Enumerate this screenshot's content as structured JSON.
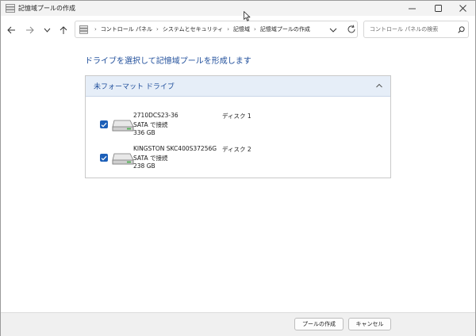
{
  "window": {
    "title": "記憶域プールの作成",
    "icon": "storage-pool-icon",
    "controls": {
      "minimize": "minimize-icon",
      "maximize": "maximize-icon",
      "close": "close-icon"
    }
  },
  "address_bar": {
    "breadcrumbs": [
      "コントロール パネル",
      "システムとセキュリティ",
      "記憶域",
      "記憶域プールの作成"
    ],
    "search_placeholder": "コントロール パネルの検索"
  },
  "main": {
    "heading": "ドライブを選択して記憶域プールを形成します",
    "group": {
      "title": "未フォーマット ドライブ",
      "expanded": true,
      "drives": [
        {
          "name": "2710DCS23-36",
          "connection": "SATA で接続",
          "size": "336 GB",
          "disk": "ディスク 1",
          "checked": true
        },
        {
          "name": "KINGSTON SKC400S37256G",
          "connection": "SATA で接続",
          "size": "238 GB",
          "disk": "ディスク 2",
          "checked": true
        }
      ]
    }
  },
  "footer": {
    "create_label": "プールの作成",
    "cancel_label": "キャンセル"
  },
  "colors": {
    "accent": "#1c5fb8",
    "heading": "#1f4e9b",
    "group_header": "#e6eef8"
  }
}
